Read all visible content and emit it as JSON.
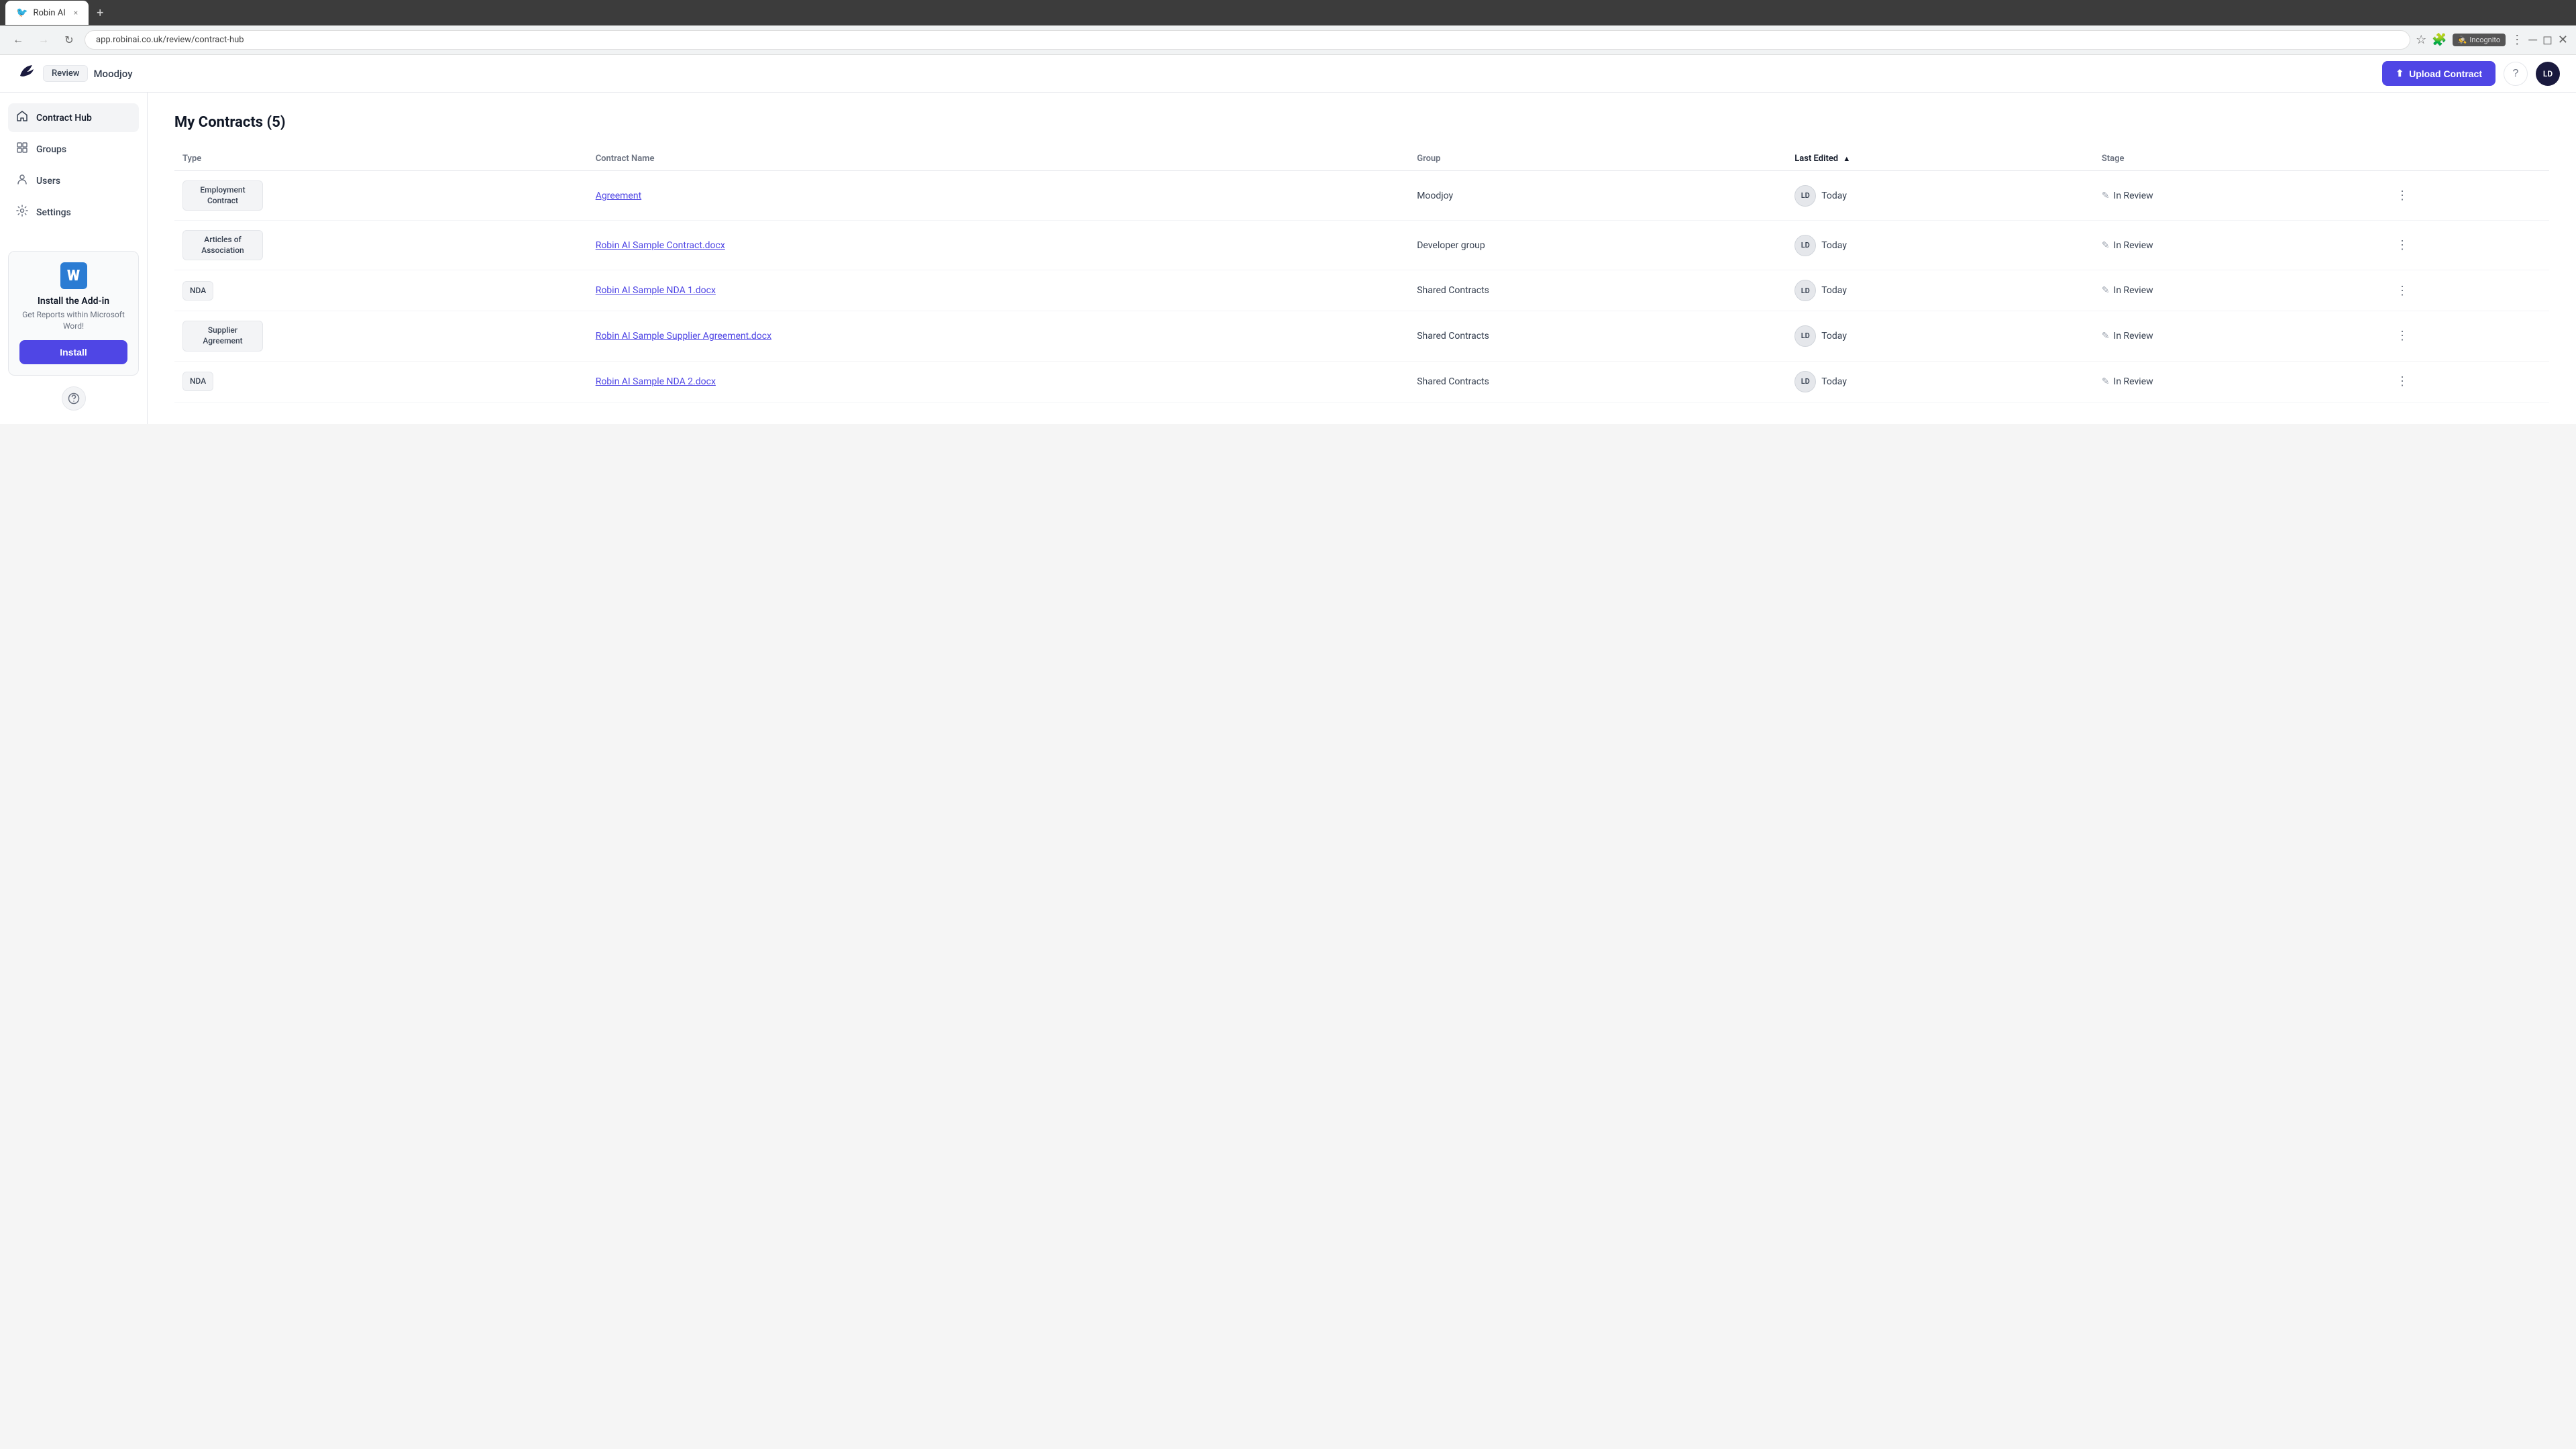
{
  "browser": {
    "tab_favicon": "🐦",
    "tab_title": "Robin AI",
    "tab_close": "×",
    "new_tab": "+",
    "back_disabled": false,
    "forward_disabled": true,
    "address": "app.robinai.co.uk/review/contract-hub",
    "incognito_label": "Incognito"
  },
  "header": {
    "logo_icon": "🐦",
    "review_label": "Review",
    "org_name": "Moodjoy",
    "upload_label": "Upload Contract",
    "upload_icon": "⬆",
    "help_icon": "?",
    "user_initials": "LD"
  },
  "sidebar": {
    "items": [
      {
        "id": "contract-hub",
        "label": "Contract Hub",
        "icon": "⌂",
        "active": true
      },
      {
        "id": "groups",
        "label": "Groups",
        "icon": "⊞",
        "active": false
      },
      {
        "id": "users",
        "label": "Users",
        "icon": "👤",
        "active": false
      },
      {
        "id": "settings",
        "label": "Settings",
        "icon": "⚙",
        "active": false
      }
    ],
    "addin": {
      "word_icon": "W",
      "title": "Install the Add-in",
      "description": "Get Reports within Microsoft Word!",
      "install_label": "Install"
    },
    "support_icon": "💬"
  },
  "main": {
    "page_title": "My Contracts (5)",
    "table": {
      "columns": [
        "Type",
        "Contract Name",
        "Group",
        "Last Edited",
        "Stage"
      ],
      "last_edited_sorted": true,
      "rows": [
        {
          "type": "Employment Contract",
          "contract_name": "Agreement",
          "group": "Moodjoy",
          "avatar": "LD",
          "date": "Today",
          "stage_icon": "✎",
          "stage": "In Review"
        },
        {
          "type": "Articles of Association",
          "contract_name": "Robin AI Sample Contract.docx",
          "group": "Developer group",
          "avatar": "LD",
          "date": "Today",
          "stage_icon": "✎",
          "stage": "In Review"
        },
        {
          "type": "NDA",
          "contract_name": "Robin AI Sample NDA 1.docx",
          "group": "Shared Contracts",
          "avatar": "LD",
          "date": "Today",
          "stage_icon": "✎",
          "stage": "In Review"
        },
        {
          "type": "Supplier Agreement",
          "contract_name": "Robin AI Sample Supplier Agreement.docx",
          "group": "Shared Contracts",
          "avatar": "LD",
          "date": "Today",
          "stage_icon": "✎",
          "stage": "In Review"
        },
        {
          "type": "NDA",
          "contract_name": "Robin AI Sample NDA 2.docx",
          "group": "Shared Contracts",
          "avatar": "LD",
          "date": "Today",
          "stage_icon": "✎",
          "stage": "In Review"
        }
      ]
    }
  }
}
